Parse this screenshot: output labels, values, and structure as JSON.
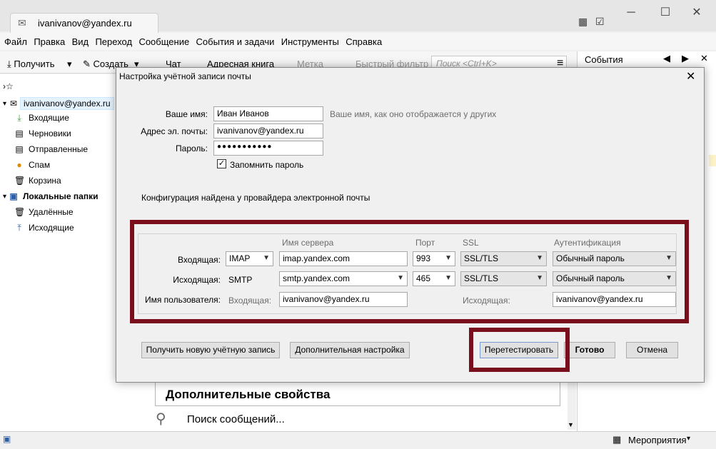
{
  "window": {
    "tab_title": "ivanivanov@yandex.ru",
    "menu": [
      "Файл",
      "Правка",
      "Вид",
      "Переход",
      "Сообщение",
      "События и задачи",
      "Инструменты",
      "Справка"
    ],
    "toolbar": {
      "get": "Получить",
      "create": "Создать",
      "chat": "Чат",
      "addressbook": "Адресная книга",
      "tag": "Метка",
      "filter": "Быстрый фильтр",
      "search_placeholder": "Поиск <Ctrl+K>"
    },
    "events_header": "События",
    "status_events": "Мероприятия"
  },
  "folders": {
    "account": "ivanivanov@yandex.ru",
    "items": [
      "Входящие",
      "Черновики",
      "Отправленные",
      "Спам",
      "Корзина"
    ],
    "local": "Локальные папки",
    "local_items": [
      "Удалённые",
      "Исходящие"
    ]
  },
  "bottom": {
    "additional_properties": "Дополнительные свойства",
    "search_messages": "Поиск сообщений..."
  },
  "dialog": {
    "title": "Настройка учётной записи почты",
    "name_label": "Ваше имя:",
    "name_value": "Иван Иванов",
    "name_hint": "Ваше имя, как оно отображается у других",
    "email_label": "Адрес эл. почты:",
    "email_value": "ivanivanov@yandex.ru",
    "password_label": "Пароль:",
    "password_value": "●●●●●●●●●●●",
    "remember_label": "Запомнить пароль",
    "found_text": "Конфигурация найдена у провайдера электронной почты",
    "columns": {
      "server": "Имя сервера",
      "port": "Порт",
      "ssl": "SSL",
      "auth": "Аутентификация"
    },
    "incoming": {
      "label": "Входящая:",
      "protocol": "IMAP",
      "server": "imap.yandex.com",
      "port": "993",
      "ssl": "SSL/TLS",
      "auth": "Обычный пароль"
    },
    "outgoing": {
      "label": "Исходящая:",
      "protocol": "SMTP",
      "server": "smtp.yandex.com",
      "port": "465",
      "ssl": "SSL/TLS",
      "auth": "Обычный пароль"
    },
    "username": {
      "label": "Имя пользователя:",
      "incoming_label": "Входящая:",
      "incoming_value": "ivanivanov@yandex.ru",
      "outgoing_label": "Исходящая:",
      "outgoing_value": "ivanivanov@yandex.ru"
    },
    "buttons": {
      "new_account": "Получить новую учётную запись",
      "advanced": "Дополнительная настройка",
      "retest": "Перетестировать",
      "done": "Готово",
      "cancel": "Отмена"
    }
  },
  "colors": {
    "highlight": "#7a0e1c",
    "selection": "#e5f3ff"
  }
}
